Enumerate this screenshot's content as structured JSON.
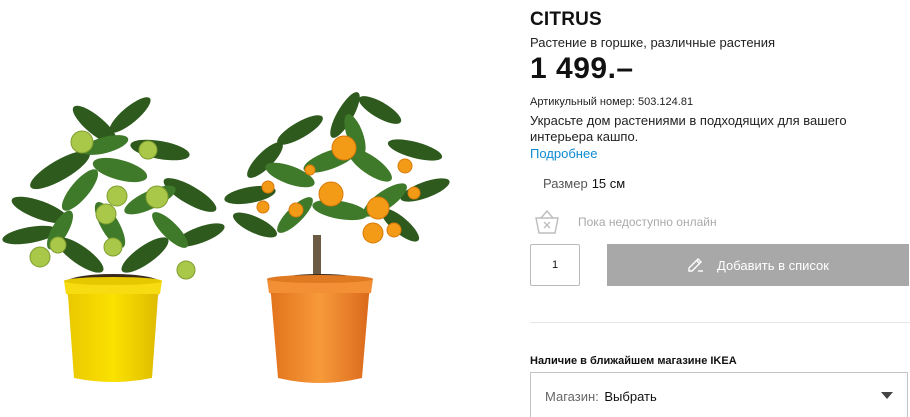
{
  "product": {
    "name": "CITRUS",
    "subtitle": "Растение в горшке, различные растения",
    "price": "1 499.–",
    "article": "Артикульный номер: 503.124.81",
    "description": "Украсьте дом растениями в подходящих для вашего интерьера кашпо.",
    "more_link": "Подробнее"
  },
  "size": {
    "label": "Размер",
    "value": "15 см"
  },
  "availability": {
    "text": "Пока недоступно онлайн",
    "icon": "basket-icon"
  },
  "cart": {
    "quantity": "1",
    "add_label": "Добавить в список",
    "icon": "pencil-icon"
  },
  "store": {
    "heading": "Наличие в ближайшем магазине IKEA",
    "label": "Магазин:",
    "value": "Выбрать"
  },
  "colors": {
    "accent_link": "#0d8ad1",
    "button_disabled": "#a8a8a8",
    "pot_yellow": "#f2d200",
    "pot_orange": "#f07f1c"
  }
}
